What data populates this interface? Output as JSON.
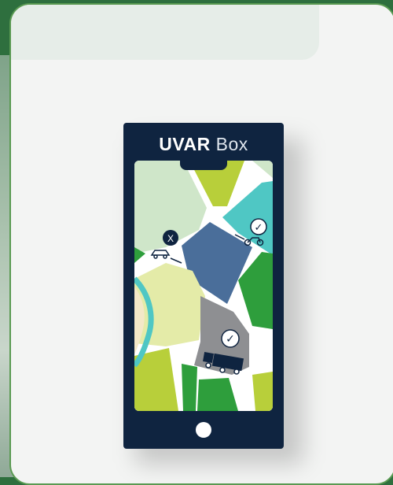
{
  "brand": {
    "name_bold": "UVAR",
    "name_light": " Box"
  },
  "map": {
    "markers": [
      {
        "type": "denied",
        "glyph": "X",
        "vehicle": "car-icon"
      },
      {
        "type": "allowed",
        "glyph": "✓",
        "vehicle": "motorcycle-icon"
      },
      {
        "type": "allowed",
        "glyph": "✓",
        "vehicle": "truck-icon"
      }
    ]
  },
  "colors": {
    "phone": "#0f2440",
    "accent_green": "#5a9a52",
    "header_bg": "#e6ede8"
  }
}
